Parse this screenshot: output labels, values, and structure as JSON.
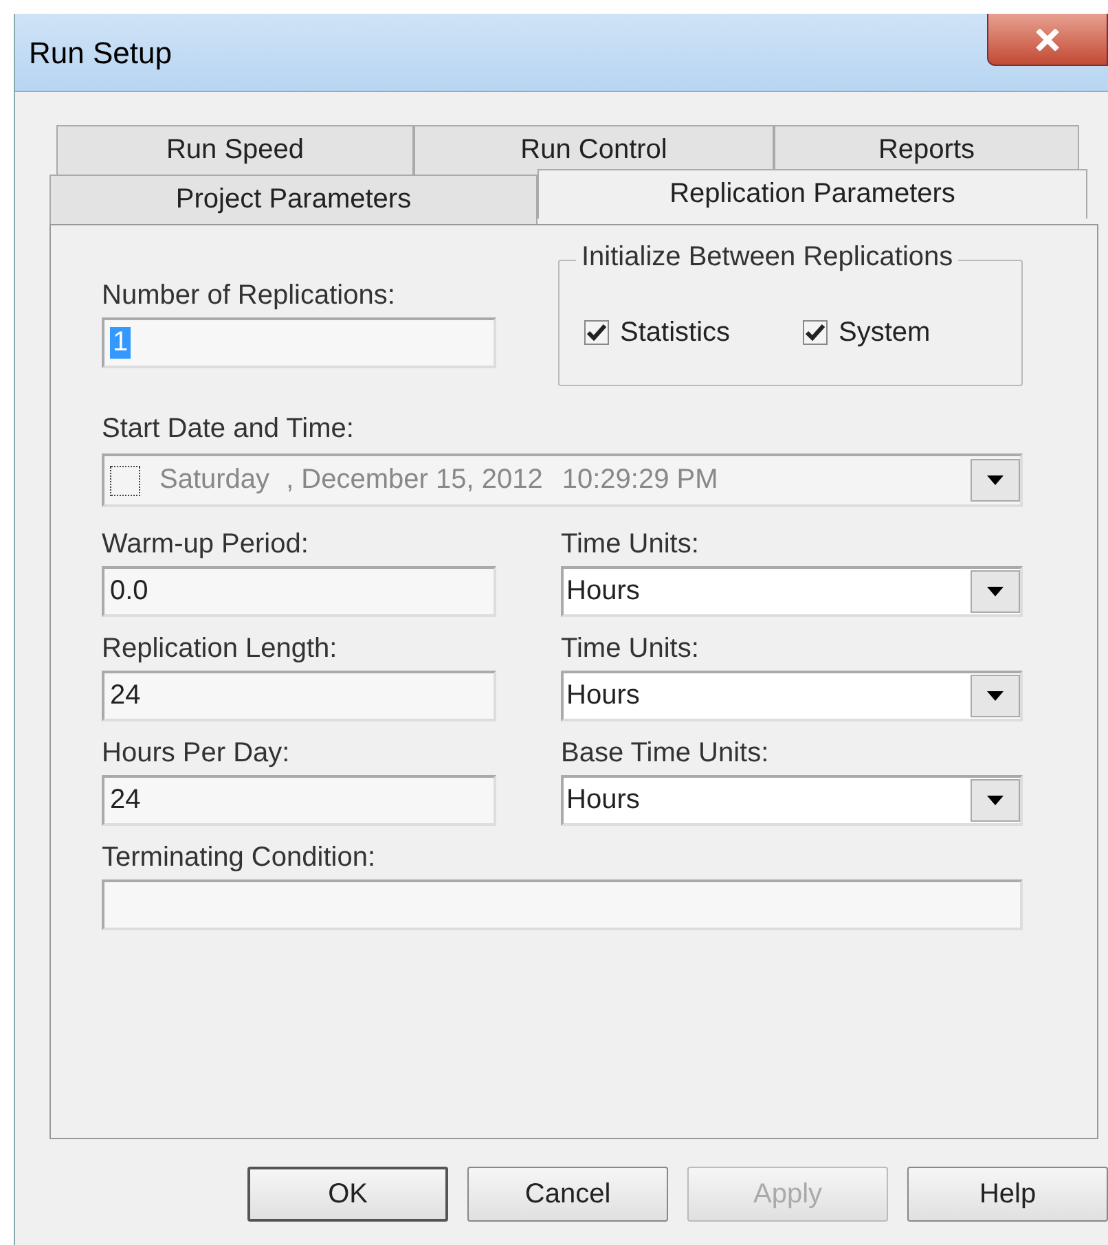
{
  "window": {
    "title": "Run Setup"
  },
  "tabs_back_row": [
    {
      "label": "Run Speed",
      "selected": false
    },
    {
      "label": "Run Control",
      "selected": false
    },
    {
      "label": "Reports",
      "selected": false
    }
  ],
  "tabs_front_row": [
    {
      "label": "Project Parameters",
      "selected": false
    },
    {
      "label": "Replication Parameters",
      "selected": true
    }
  ],
  "replications": {
    "label": "Number of Replications:",
    "value": "1",
    "text_selected": true
  },
  "initialize_group": {
    "title": "Initialize Between Replications",
    "options": [
      {
        "label": "Statistics",
        "checked": true
      },
      {
        "label": "System",
        "checked": true
      }
    ]
  },
  "start_date": {
    "label": "Start Date and Time:",
    "checked": false,
    "disabled": true,
    "day": "Saturday",
    "date": ", December 15, 2012",
    "time": "10:29:29 PM"
  },
  "fields": [
    {
      "label": "Warm-up Period:",
      "value": "0.0",
      "unit_label": "Time Units:",
      "unit": "Hours"
    },
    {
      "label": "Replication Length:",
      "value": "24",
      "unit_label": "Time Units:",
      "unit": "Hours"
    },
    {
      "label": "Hours Per Day:",
      "value": "24",
      "unit_label": "Base Time Units:",
      "unit": "Hours"
    }
  ],
  "terminating": {
    "label": "Terminating Condition:"
  },
  "buttons": [
    {
      "label": "OK",
      "disabled": false,
      "default": true
    },
    {
      "label": "Cancel",
      "disabled": false,
      "default": false
    },
    {
      "label": "Apply",
      "disabled": true,
      "default": false
    },
    {
      "label": "Help",
      "disabled": false,
      "default": false
    }
  ]
}
